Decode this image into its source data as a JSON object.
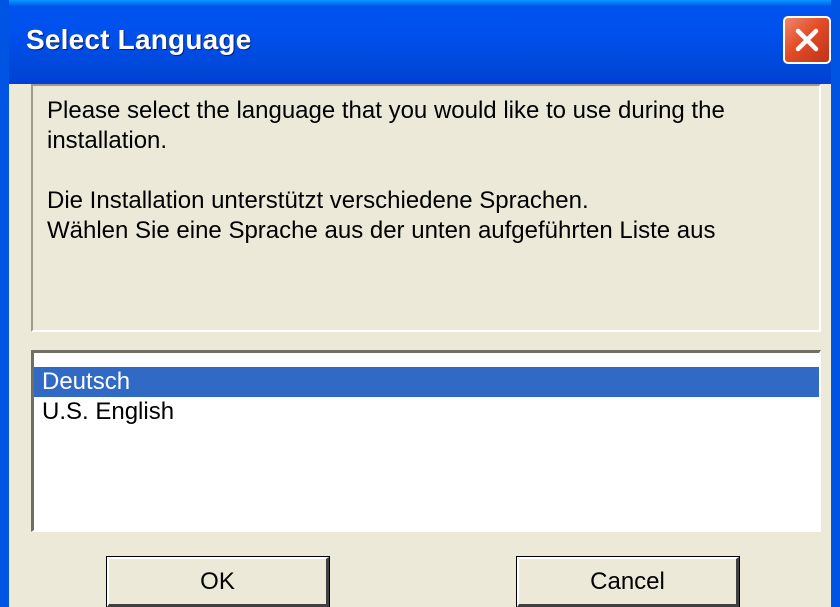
{
  "window": {
    "title": "Select Language"
  },
  "info": {
    "line1": "Please select the language that you would like to use during the",
    "line2": "installation.",
    "line3": "Die Installation unterstützt verschiedene Sprachen.",
    "line4": "Wählen Sie eine Sprache aus der unten aufgeführten Liste aus"
  },
  "languages": {
    "items": [
      {
        "label": "Deutsch",
        "selected": true
      },
      {
        "label": "U.S. English",
        "selected": false
      }
    ]
  },
  "buttons": {
    "ok_label": "OK",
    "cancel_label": "Cancel"
  },
  "icons": {
    "close": "close-icon"
  },
  "colors": {
    "titlebar": "#0054e3",
    "selection": "#316ac5",
    "close_button": "#e24d27",
    "dialog_background": "#ece9d8"
  }
}
